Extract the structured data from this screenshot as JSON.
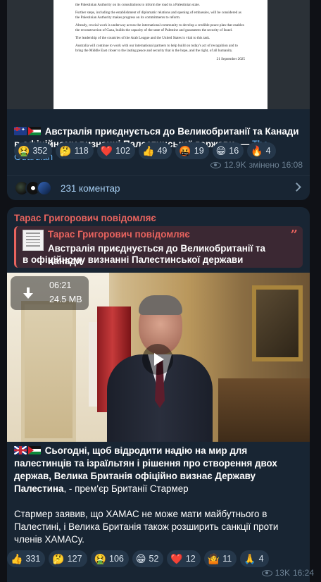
{
  "post1": {
    "document": {
      "partial_line": "the Palestinian Authority on its consultations to inform the road to a Palestinian state.",
      "paragraphs": [
        "Further steps, including the establishment of diplomatic relations and opening of embassies, will be considered as the Palestinian Authority makes progress on its commitments to reform.",
        "Already, crucial work is underway across the international community to develop a credible peace plan that enables the reconstruction of Gaza, builds the capacity of the state of Palestine and guarantees the security of Israel.",
        "The leadership of the countries of the Arab League and the United States is vital to this task.",
        "Australia will continue to work with our international partners to help build on today's act of recognition and to bring the Middle East closer to the lasting peace and security that is the hope, and the right, of all humanity."
      ],
      "date": "21 September 2025"
    },
    "caption": "Австралія приєднується до Великобританії та Канади в офіційному визнанні Палестинської держави, — ",
    "source_link": "The Guardian",
    "reactions": [
      {
        "emoji": "🤮",
        "count": "352"
      },
      {
        "emoji": "🤔",
        "count": "118"
      },
      {
        "emoji": "❤️",
        "count": "102"
      },
      {
        "emoji": "👍",
        "count": "49"
      },
      {
        "emoji": "🤬",
        "count": "19"
      },
      {
        "emoji": "😁",
        "count": "16"
      },
      {
        "emoji": "🔥",
        "count": "4"
      }
    ],
    "views": "12.9K",
    "edited_time": "змінено 16:08",
    "comments_label": "231 коментар"
  },
  "post2": {
    "author": "Тарас Григорович повідомляє",
    "reply": {
      "author": "Тарас Григорович повідомляє",
      "text_line1": "Австралія приєднується до Великобританії та Канади",
      "text_line2": "в офіційному визнанні Палестинської держави"
    },
    "video": {
      "duration": "06:21",
      "size": "24.5 MB"
    },
    "text_bold": "Сьогодні, щоб відродити надію на мир для палестинців та ізраїльтян і рішення про створення двох держав, Велика Британія офіційно визнає Державу Палестина",
    "text_tail": ", - прем'єр Британії Стармер",
    "text_p2": "Стармер заявив, що ХАМАС не може мати майбутнього в Палестині, і Велика Британія також розширить санкції проти членів ХАМАСу.",
    "reactions": [
      {
        "emoji": "👍",
        "count": "331"
      },
      {
        "emoji": "🤔",
        "count": "127"
      },
      {
        "emoji": "🤮",
        "count": "106"
      },
      {
        "emoji": "😁",
        "count": "52"
      },
      {
        "emoji": "❤️",
        "count": "12"
      },
      {
        "emoji": "🤷",
        "count": "11"
      },
      {
        "emoji": "🙏",
        "count": "4"
      }
    ],
    "views": "13K",
    "time": "16:24"
  }
}
